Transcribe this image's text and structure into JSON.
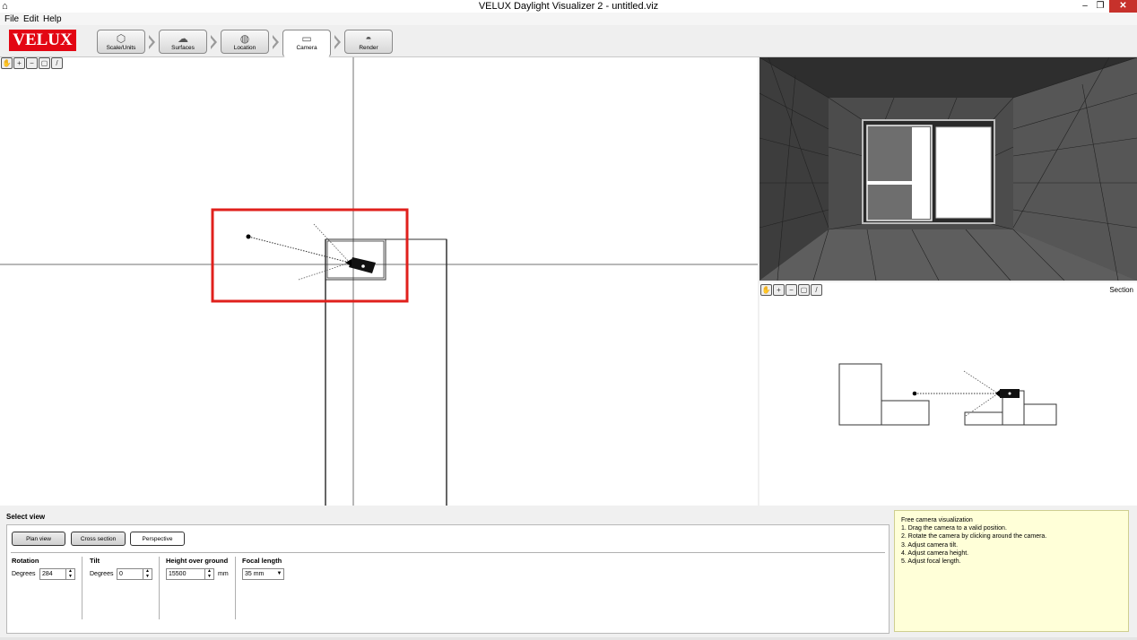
{
  "window": {
    "title": "VELUX Daylight Visualizer 2 - untitled.viz",
    "minimize_label": "–",
    "maximize_label": "❐",
    "close_label": "✕"
  },
  "menu": [
    "File",
    "Edit",
    "Help"
  ],
  "logo": "VELUX",
  "steps": [
    {
      "label": "Scale/Units",
      "icon": "scale-icon"
    },
    {
      "label": "Surfaces",
      "icon": "palette-icon"
    },
    {
      "label": "Location",
      "icon": "globe-icon"
    },
    {
      "label": "Camera",
      "icon": "camera-icon",
      "active": true
    },
    {
      "label": "Render",
      "icon": "render-icon"
    }
  ],
  "section_label": "Section",
  "select_view": {
    "label": "Select view",
    "buttons": [
      "Plan view",
      "Cross section",
      "Perspective"
    ]
  },
  "rotation": {
    "title": "Rotation",
    "unit_label": "Degrees",
    "value": "284"
  },
  "tilt": {
    "title": "Tilt",
    "unit_label": "Degrees",
    "value": "0"
  },
  "height": {
    "title": "Height over ground",
    "value": "15500",
    "unit": "mm"
  },
  "focal": {
    "title": "Focal length",
    "value": "35 mm"
  },
  "info": {
    "title": "Free camera visualization",
    "steps": [
      "1. Drag the camera to a valid position.",
      "2. Rotate the camera by clicking around the camera.",
      "3. Adjust camera tilt.",
      "4. Adjust camera height.",
      "5. Adjust focal length."
    ]
  },
  "colors": {
    "accent_red": "#e30613",
    "highlight_box": "#e0201c",
    "info_bg": "#ffffd8"
  }
}
